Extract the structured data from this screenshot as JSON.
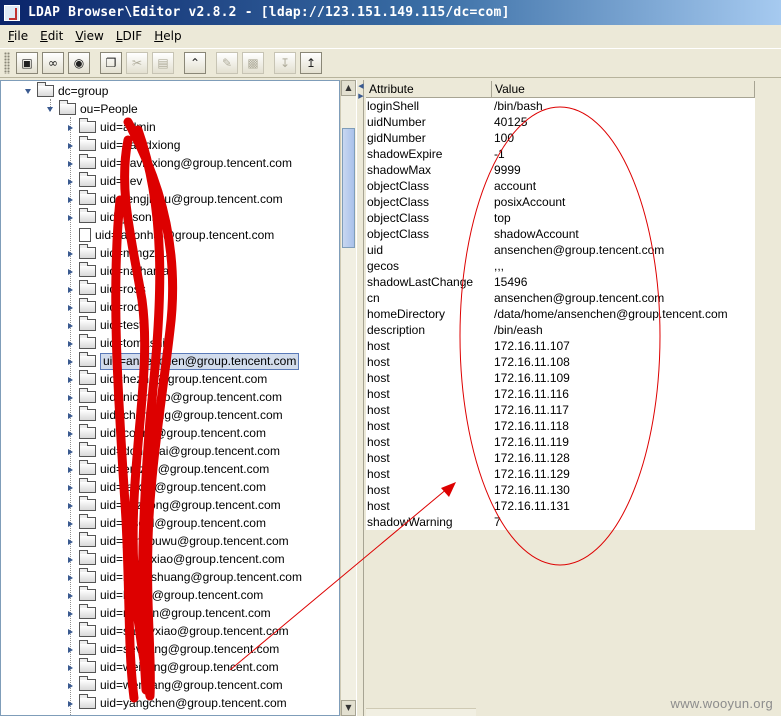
{
  "window": {
    "title": "LDAP Browser\\Editor v2.8.2 - [ldap://123.151.149.115/dc=com]"
  },
  "menu": {
    "items": [
      "File",
      "Edit",
      "View",
      "LDIF",
      "Help"
    ]
  },
  "toolbar": {
    "icons": [
      "connect-icon",
      "disconnect-icon",
      "search-icon",
      "copy-icon",
      "cut-icon",
      "paste-icon",
      "up-icon",
      "edit-icon",
      "delete-icon",
      "import-icon",
      "export-icon"
    ]
  },
  "tree": {
    "nodes": [
      {
        "label": "dc=group",
        "depth": 0,
        "type": "folder",
        "expanded": true
      },
      {
        "label": "ou=People",
        "depth": 1,
        "type": "folder",
        "expanded": true
      },
      {
        "label": "uid=admin",
        "depth": 2,
        "type": "folder"
      },
      {
        "label": "uid=davidxiong",
        "depth": 2,
        "type": "folder"
      },
      {
        "label": "uid=davidxiong@group.tencent.com",
        "depth": 2,
        "type": "folder"
      },
      {
        "label": "uid=dev",
        "depth": 2,
        "type": "folder"
      },
      {
        "label": "uid=fengjiaxu@group.tencent.com",
        "depth": 2,
        "type": "folder"
      },
      {
        "label": "uid=jasonhai",
        "depth": 2,
        "type": "folder"
      },
      {
        "label": "uid=jasonhai@group.tencent.com",
        "depth": 2,
        "type": "document"
      },
      {
        "label": "uid=mingzhu",
        "depth": 2,
        "type": "folder"
      },
      {
        "label": "uid=nathaniao",
        "depth": 2,
        "type": "folder"
      },
      {
        "label": "uid=ross",
        "depth": 2,
        "type": "folder"
      },
      {
        "label": "uid=root",
        "depth": 2,
        "type": "folder"
      },
      {
        "label": "uid=test",
        "depth": 2,
        "type": "folder"
      },
      {
        "label": "uid=tomashi",
        "depth": 2,
        "type": "folder"
      },
      {
        "label": "uid=ansenchen@group.tencent.com",
        "depth": 2,
        "type": "folder",
        "selected": true
      },
      {
        "label": "uid=hezhu@group.tencent.com",
        "depth": 2,
        "type": "folder"
      },
      {
        "label": "uid=nickmiao@group.tencent.com",
        "depth": 2,
        "type": "folder"
      },
      {
        "label": "uid=chenxing@group.tencent.com",
        "depth": 2,
        "type": "folder"
      },
      {
        "label": "uid=corinli@group.tencent.com",
        "depth": 2,
        "type": "folder"
      },
      {
        "label": "uid=donnalai@group.tencent.com",
        "depth": 2,
        "type": "folder"
      },
      {
        "label": "uid=emzliu@group.tencent.com",
        "depth": 2,
        "type": "folder"
      },
      {
        "label": "uid=feixyu@group.tencent.com",
        "depth": 2,
        "type": "folder"
      },
      {
        "label": "uid=huzhong@group.tencent.com",
        "depth": 2,
        "type": "folder"
      },
      {
        "label": "uid=jasonl@group.tencent.com",
        "depth": 2,
        "type": "folder"
      },
      {
        "label": "uid=jiangpuwu@group.tencent.com",
        "depth": 2,
        "type": "folder"
      },
      {
        "label": "uid=kevinxiao@group.tencent.com",
        "depth": 2,
        "type": "folder"
      },
      {
        "label": "uid=kevinshuang@group.tencent.com",
        "depth": 2,
        "type": "folder"
      },
      {
        "label": "uid=lifeng@group.tencent.com",
        "depth": 2,
        "type": "folder"
      },
      {
        "label": "uid=mason@group.tencent.com",
        "depth": 2,
        "type": "folder"
      },
      {
        "label": "uid=sandyxiao@group.tencent.com",
        "depth": 2,
        "type": "folder"
      },
      {
        "label": "uid=sevyang@group.tencent.com",
        "depth": 2,
        "type": "folder"
      },
      {
        "label": "uid=weizeng@group.tencent.com",
        "depth": 2,
        "type": "folder"
      },
      {
        "label": "uid=wenyang@group.tencent.com",
        "depth": 2,
        "type": "folder"
      },
      {
        "label": "uid=yangchen@group.tencent.com",
        "depth": 2,
        "type": "folder"
      }
    ]
  },
  "attributes": {
    "columns": [
      "Attribute",
      "Value"
    ],
    "rows": [
      [
        "loginShell",
        "/bin/bash"
      ],
      [
        "uidNumber",
        "40125"
      ],
      [
        "gidNumber",
        "100"
      ],
      [
        "shadowExpire",
        "-1"
      ],
      [
        "shadowMax",
        "9999"
      ],
      [
        "objectClass",
        "account"
      ],
      [
        "objectClass",
        "posixAccount"
      ],
      [
        "objectClass",
        "top"
      ],
      [
        "objectClass",
        "shadowAccount"
      ],
      [
        "uid",
        "ansenchen@group.tencent.com"
      ],
      [
        "gecos",
        ",,,"
      ],
      [
        "shadowLastChange",
        "15496"
      ],
      [
        "cn",
        "ansenchen@group.tencent.com"
      ],
      [
        "homeDirectory",
        "/data/home/ansenchen@group.tencent.com"
      ],
      [
        "description",
        "/bin/eash"
      ],
      [
        "host",
        "172.16.11.107"
      ],
      [
        "host",
        "172.16.11.108"
      ],
      [
        "host",
        "172.16.11.109"
      ],
      [
        "host",
        "172.16.11.116"
      ],
      [
        "host",
        "172.16.11.117"
      ],
      [
        "host",
        "172.16.11.118"
      ],
      [
        "host",
        "172.16.11.119"
      ],
      [
        "host",
        "172.16.11.128"
      ],
      [
        "host",
        "172.16.11.129"
      ],
      [
        "host",
        "172.16.11.130"
      ],
      [
        "host",
        "172.16.11.131"
      ],
      [
        "shadowWarning",
        "7"
      ]
    ]
  },
  "watermark": "www.wooyun.org",
  "colors": {
    "annotation": "#dd0000",
    "selection": "#d2dcec",
    "titlebar": "#0a246a"
  }
}
